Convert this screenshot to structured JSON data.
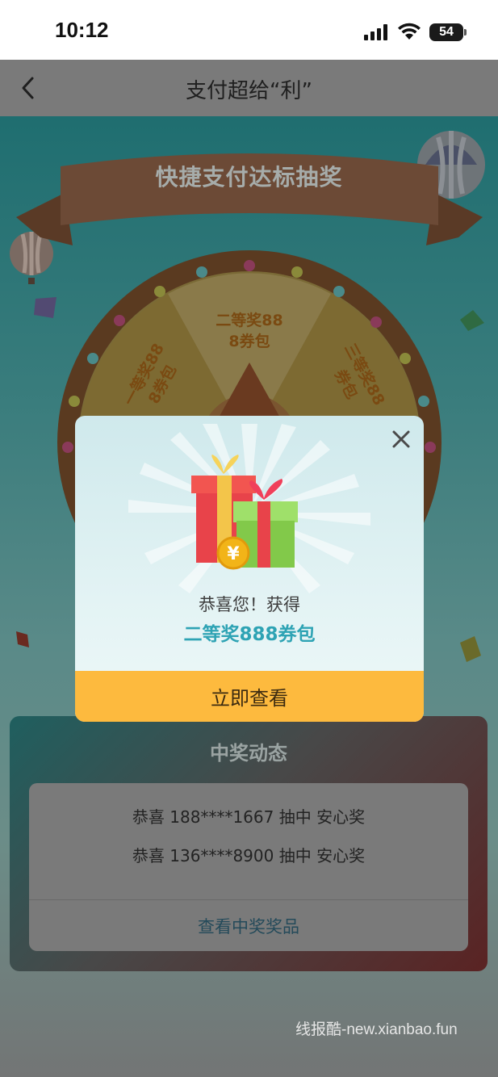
{
  "status_bar": {
    "time": "10:12",
    "battery": "54"
  },
  "nav": {
    "title": "支付超给“利”"
  },
  "banner": {
    "title": "快捷支付达标抽奖"
  },
  "wheel": {
    "segments": [
      {
        "label": "二等奖88\n8券包"
      },
      {
        "label": "一等奖88\n8券包"
      },
      {
        "label": "三等奖88\n券包"
      }
    ]
  },
  "winners": {
    "title": "中奖动态",
    "rows": [
      "恭喜 188****1667 抽中 安心奖",
      "恭喜 136****8900 抽中 安心奖"
    ],
    "view_prizes": "查看中奖奖品"
  },
  "modal": {
    "line1": "恭喜您！获得",
    "line2": "二等奖888券包",
    "cta": "立即查看"
  },
  "watermark": "线报酷-new.xianbao.fun",
  "colors": {
    "accent": "#2ea3b4",
    "cta": "#fdba3e"
  },
  "icons": [
    "back-chevron-icon",
    "close-icon",
    "gift-icon",
    "yen-coin-icon",
    "hot-air-balloon-icon"
  ]
}
